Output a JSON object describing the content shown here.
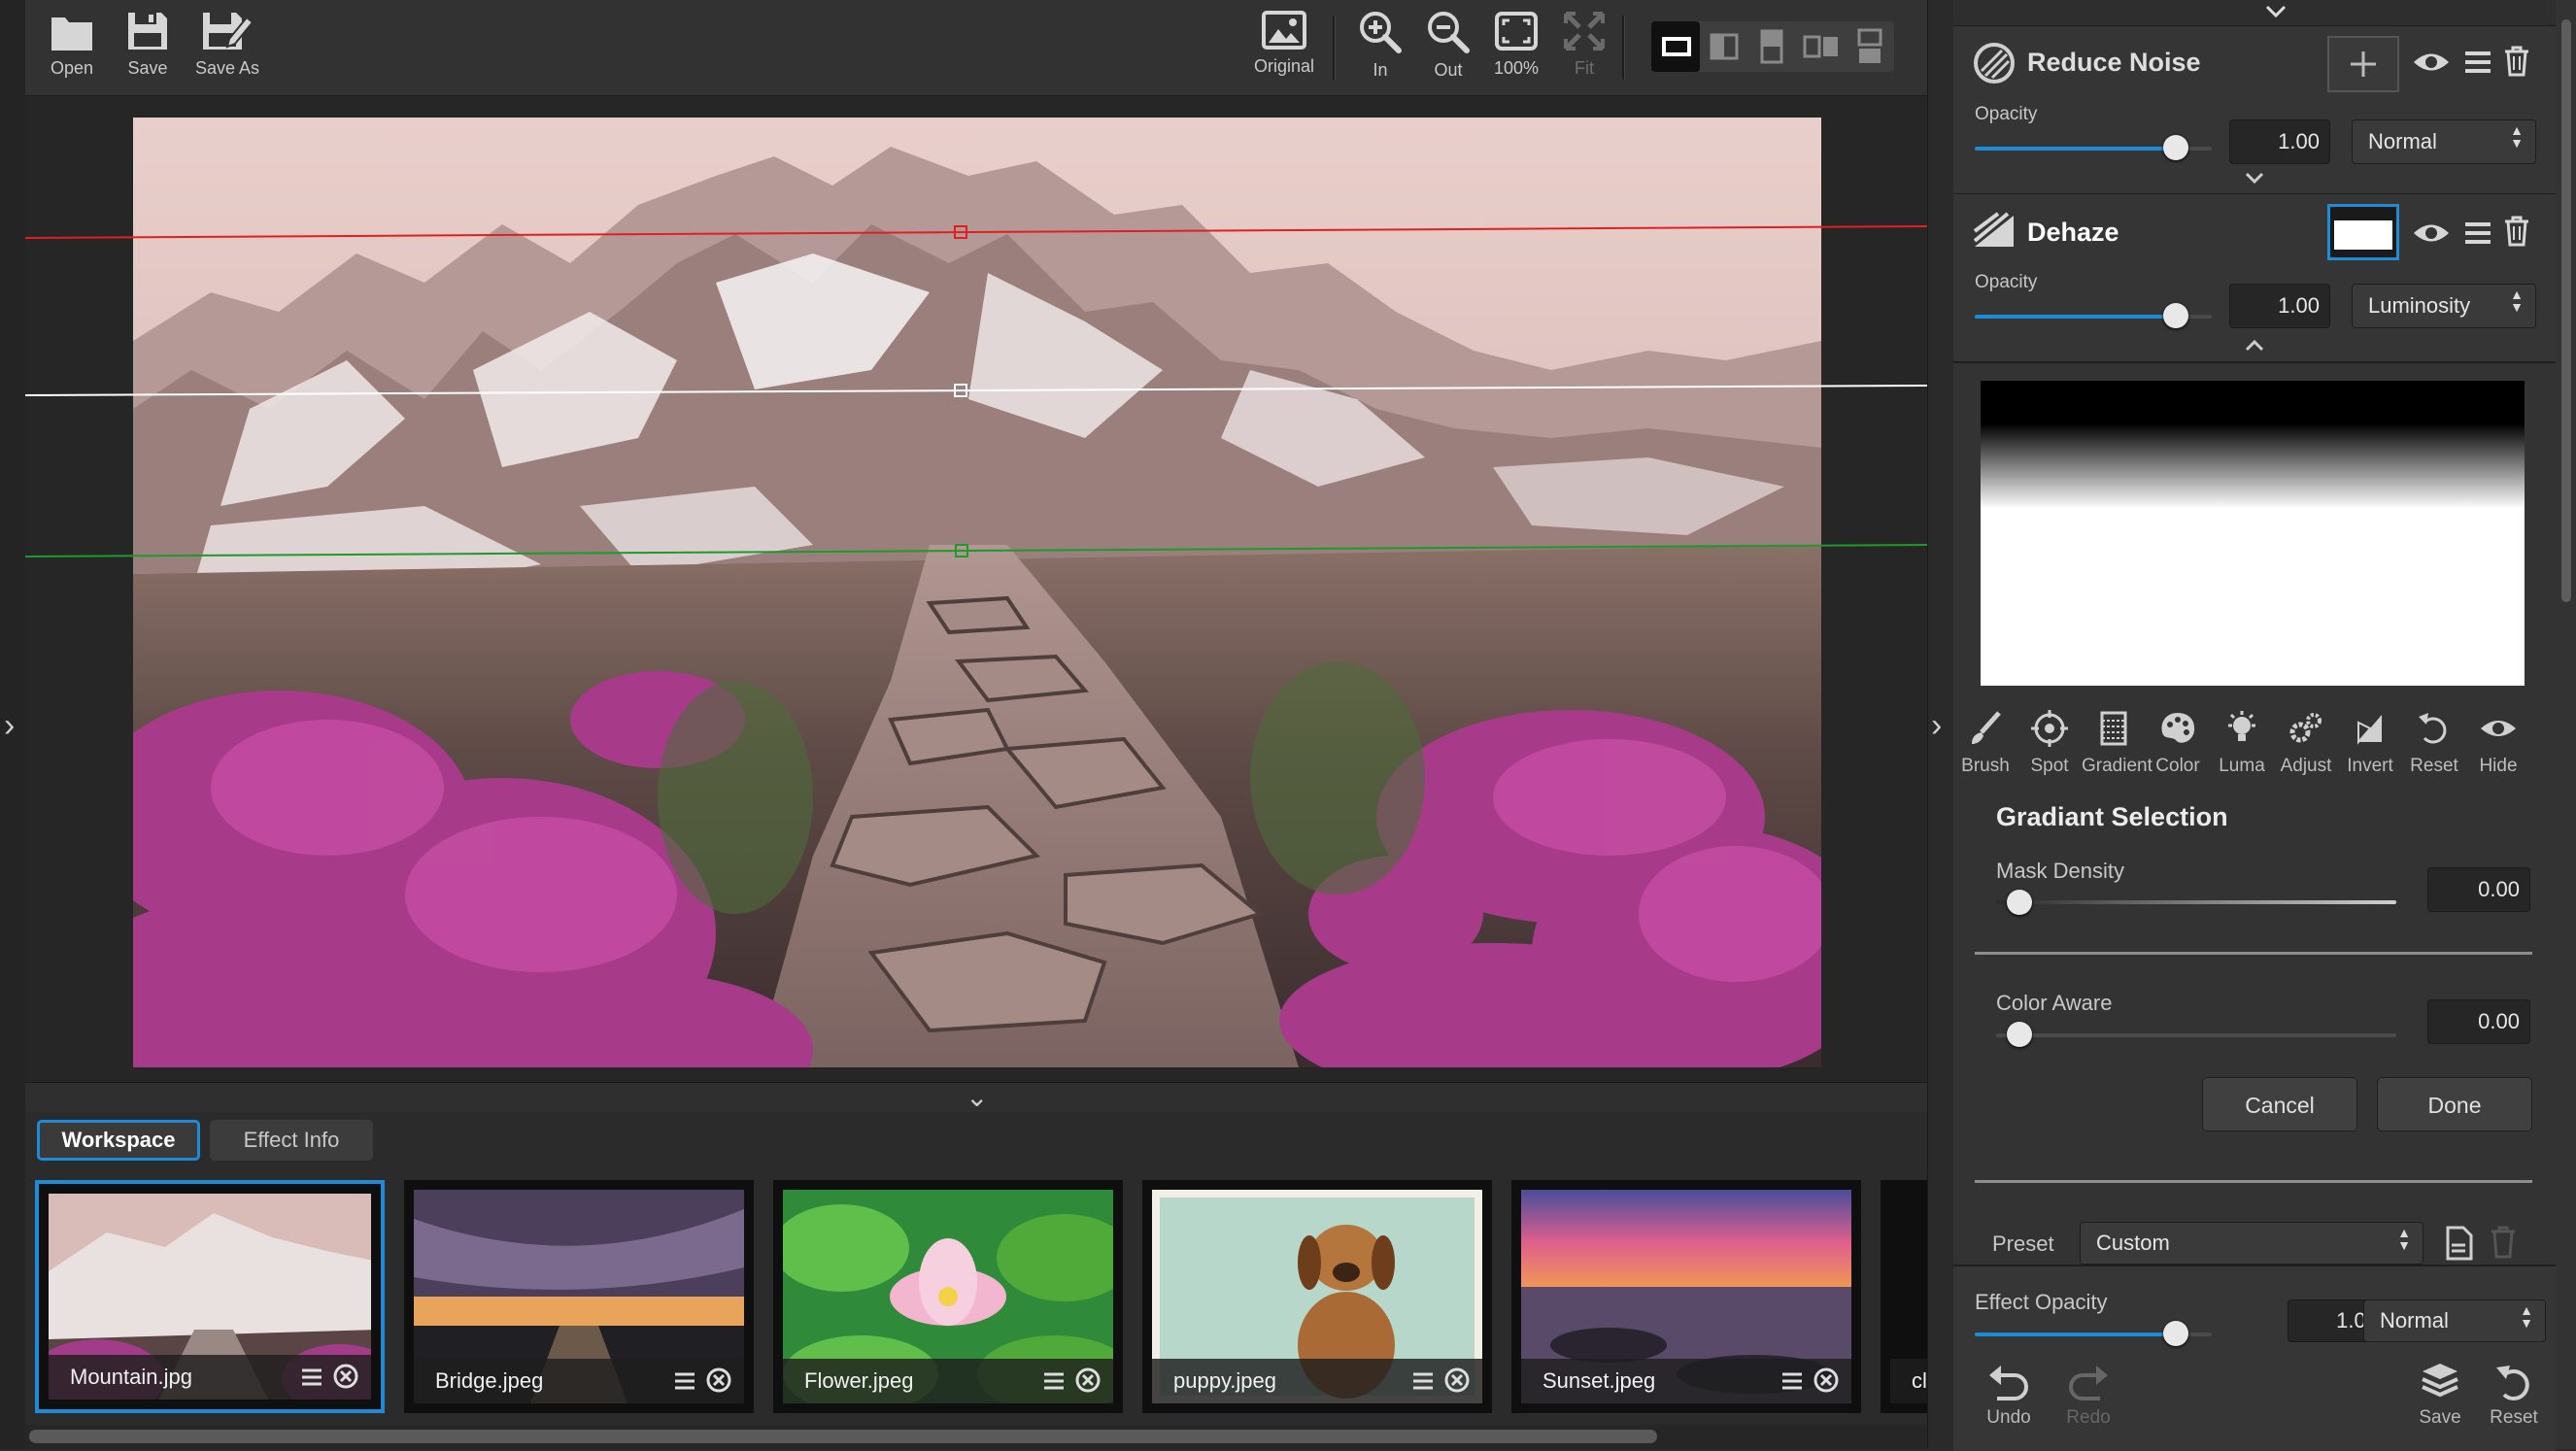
{
  "toolbar": {
    "open_label": "Open",
    "save_label": "Save",
    "save_as_label": "Save As",
    "original_label": "Original",
    "zoom_in_label": "In",
    "zoom_out_label": "Out",
    "zoom_100_label": "100%",
    "fit_label": "Fit"
  },
  "workspace": {
    "tabs": [
      "Workspace",
      "Effect Info"
    ],
    "active_tab": "Workspace",
    "thumbnails": [
      {
        "name": "Mountain.jpg",
        "selected": true
      },
      {
        "name": "Bridge.jpeg",
        "selected": false
      },
      {
        "name": "Flower.jpeg",
        "selected": false
      },
      {
        "name": "puppy.jpeg",
        "selected": false
      },
      {
        "name": "Sunset.jpeg",
        "selected": false
      },
      {
        "name": "cl",
        "selected": false
      }
    ]
  },
  "layers": [
    {
      "title": "Reduce Noise",
      "opacity_label": "Opacity",
      "opacity": "1.00",
      "opacity_fraction": 0.85,
      "blend_mode": "Normal"
    },
    {
      "title": "Dehaze",
      "opacity_label": "Opacity",
      "opacity": "1.00",
      "opacity_fraction": 0.85,
      "blend_mode": "Luminosity"
    }
  ],
  "mask_tools": [
    "Brush",
    "Spot",
    "Gradient",
    "Color",
    "Luma",
    "Adjust",
    "Invert",
    "Reset",
    "Hide"
  ],
  "gradient_selection": {
    "title": "Gradiant Selection",
    "mask_density_label": "Mask Density",
    "mask_density": "0.00",
    "color_aware_label": "Color Aware",
    "color_aware": "0.00",
    "cancel_label": "Cancel",
    "done_label": "Done"
  },
  "preset": {
    "label": "Preset",
    "value": "Custom"
  },
  "effect_opacity": {
    "label": "Effect Opacity",
    "value": "1.00",
    "fraction": 0.85,
    "blend_mode": "Normal"
  },
  "bottom_actions": {
    "undo": "Undo",
    "redo": "Redo",
    "save": "Save",
    "reset": "Reset"
  },
  "colors": {
    "accent": "#1e8bd8",
    "guide_top": "#e02020",
    "guide_mid": "#ffffff",
    "guide_bottom": "#1d9a2a"
  }
}
